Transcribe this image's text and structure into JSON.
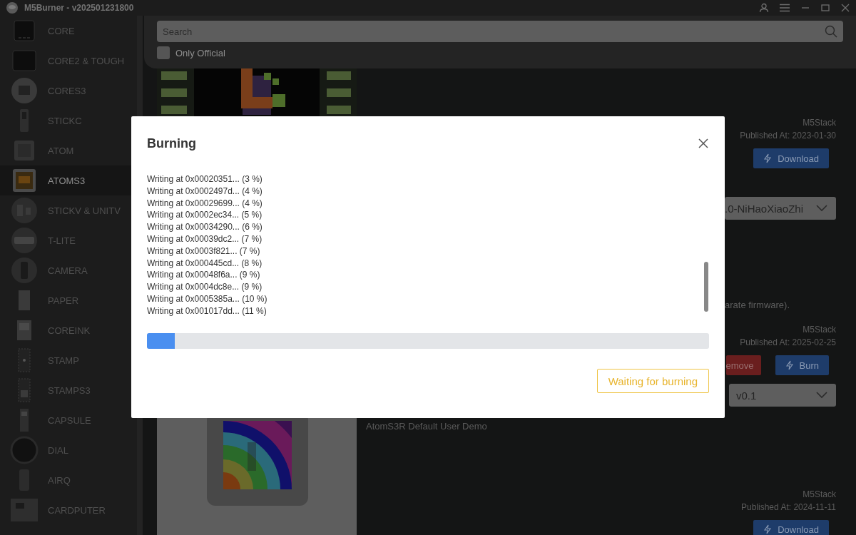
{
  "window": {
    "title": "M5Burner - v202501231800"
  },
  "sidebar": {
    "items": [
      {
        "label": "CORE",
        "selected": false
      },
      {
        "label": "CORE2 & TOUGH",
        "selected": false
      },
      {
        "label": "CORES3",
        "selected": false
      },
      {
        "label": "STICKC",
        "selected": false
      },
      {
        "label": "ATOM",
        "selected": false
      },
      {
        "label": "ATOMS3",
        "selected": true
      },
      {
        "label": "STICKV & UNITV",
        "selected": false
      },
      {
        "label": "T-LITE",
        "selected": false
      },
      {
        "label": "CAMERA",
        "selected": false
      },
      {
        "label": "PAPER",
        "selected": false
      },
      {
        "label": "COREINK",
        "selected": false
      },
      {
        "label": "STAMP",
        "selected": false
      },
      {
        "label": "STAMPS3",
        "selected": false
      },
      {
        "label": "CAPSULE",
        "selected": false
      },
      {
        "label": "DIAL",
        "selected": false
      },
      {
        "label": "AIRQ",
        "selected": false
      },
      {
        "label": "CARDPUTER",
        "selected": false
      }
    ]
  },
  "search": {
    "placeholder": "Search"
  },
  "filters": [
    {
      "label": "Only Official",
      "checked": false
    }
  ],
  "firmware": [
    {
      "author": "M5Stack",
      "published": "Published At: 2023-01-30",
      "buttons": [
        {
          "kind": "download",
          "label": "Download"
        }
      ],
      "version": ".0-NiHaoXiaoZhi",
      "description": "arate firmware)."
    },
    {
      "author": "M5Stack",
      "published": "Published At: 2025-02-25",
      "buttons": [
        {
          "kind": "remove",
          "label": "emove"
        },
        {
          "kind": "burn",
          "label": "Burn"
        }
      ],
      "version": "v0.1",
      "title": "AtomS3R Default User Demo"
    },
    {
      "author": "M5Stack",
      "published": "Published At: 2024-11-11",
      "buttons": [
        {
          "kind": "download",
          "label": "Download"
        }
      ]
    }
  ],
  "dialog": {
    "title": "Burning",
    "log": [
      "Writing at 0x00020351... (3 %)",
      "Writing at 0x0002497d... (4 %)",
      "Writing at 0x00029699... (4 %)",
      "Writing at 0x0002ec34... (5 %)",
      "Writing at 0x00034290... (6 %)",
      "Writing at 0x00039dc2... (7 %)",
      "Writing at 0x0003f821... (7 %)",
      "Writing at 0x000445cd... (8 %)",
      "Writing at 0x00048f6a... (9 %)",
      "Writing at 0x0004dc8e... (9 %)",
      "Writing at 0x0005385a... (10 %)",
      "Writing at 0x001017dd... (11 %)"
    ],
    "progress": {
      "level": 0.05
    },
    "button": {
      "label": "Waiting for burning"
    }
  }
}
